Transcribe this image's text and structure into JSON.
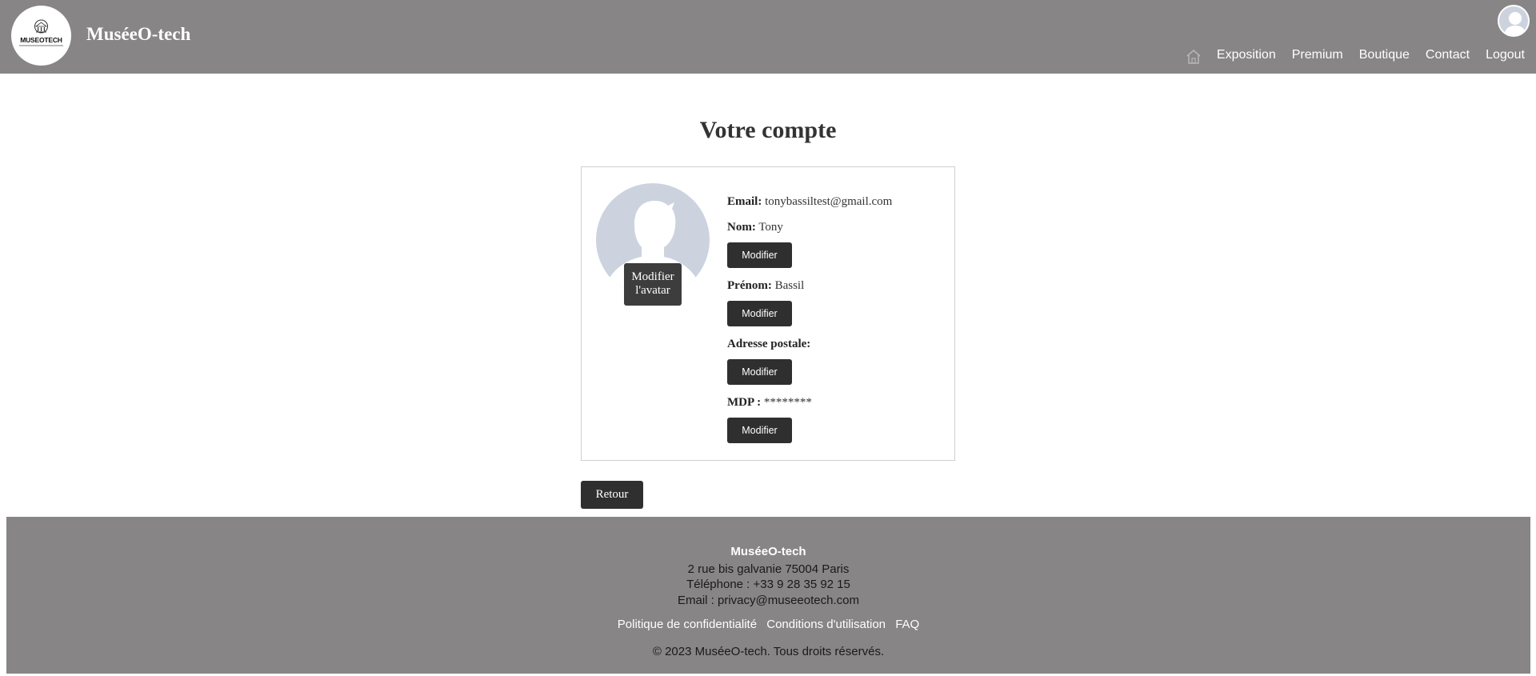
{
  "header": {
    "logo_text": "MUSEOTECH",
    "site_title": "MuséeO-tech",
    "nav": {
      "home_icon": "home-icon",
      "links": [
        "Exposition",
        "Premium",
        "Boutique",
        "Contact",
        "Logout"
      ]
    }
  },
  "account": {
    "title": "Votre compte",
    "avatar_button": "Modifier l'avatar",
    "email_label": "Email:",
    "email_value": "tonybassiltest@gmail.com",
    "nom_label": "Nom:",
    "nom_value": "Tony",
    "prenom_label": "Prénom:",
    "prenom_value": "Bassil",
    "adresse_label": "Adresse postale:",
    "adresse_value": "",
    "mdp_label": "MDP :",
    "mdp_value": "********",
    "modify_label": "Modifier",
    "back_label": "Retour"
  },
  "footer": {
    "brand": "MuséeO-tech",
    "address": "2 rue bis galvanie 75004 Paris",
    "phone": "Téléphone : +33 9 28 35 92 15",
    "email": "Email : privacy@museeotech.com",
    "links": [
      "Politique de confidentialité",
      "Conditions d'utilisation",
      "FAQ"
    ],
    "copyright": "© 2023 MuséeO-tech. Tous droits réservés."
  },
  "colors": {
    "header_bg": "#878586",
    "button_bg": "#2f2f2f",
    "avatar_bg": "#ccd3df"
  }
}
